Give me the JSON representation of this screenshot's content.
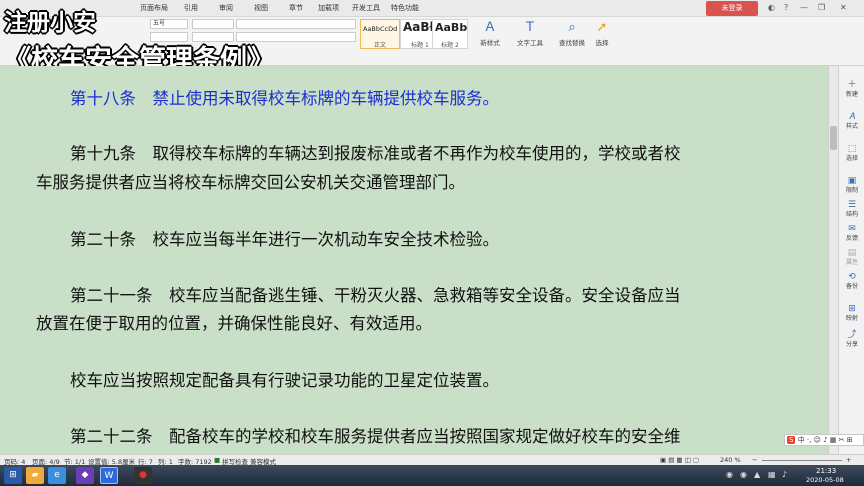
{
  "menu": {
    "items": [
      "页面布局",
      "引用",
      "审阅",
      "视图",
      "章节",
      "加载项",
      "开发工具",
      "特色功能"
    ],
    "login": "未登录"
  },
  "toolbar": {
    "font_size": "五号",
    "styles": [
      {
        "sample": "AaBbCcDd",
        "label": "正文"
      },
      {
        "sample": "AaBł",
        "label": "标题 1"
      },
      {
        "sample": "AaBb",
        "label": "标题 2"
      }
    ],
    "new_style": "新样式",
    "text_tools": "文字工具",
    "find_replace": "查找替换",
    "select": "选择"
  },
  "overlay": {
    "line1": "注册小安",
    "line2": "《校车安全管理条例》"
  },
  "document": {
    "paragraphs": [
      {
        "lines": [
          "第十八条　禁止使用未取得校车标牌的车辆提供校车服务。"
        ],
        "heading": true
      },
      {
        "lines": [
          "第十九条　取得校车标牌的车辆达到报废标准或者不再作为校车使用的，学校或者校",
          "车服务提供者应当将校车标牌交回公安机关交通管理部门。"
        ]
      },
      {
        "lines": [
          "第二十条　校车应当每半年进行一次机动车安全技术检验。"
        ]
      },
      {
        "lines": [
          "第二十一条　校车应当配备逃生锤、干粉灭火器、急救箱等安全设备。安全设备应当",
          "放置在便于取用的位置，并确保性能良好、有效适用。"
        ]
      },
      {
        "lines": [
          "校车应当按照规定配备具有行驶记录功能的卫星定位装置。"
        ]
      },
      {
        "lines": [
          "第二十二条　配备校车的学校和校车服务提供者应当按照国家规定做好校车的安全维"
        ]
      }
    ]
  },
  "right_pane": [
    "新建",
    "样式",
    "选择",
    "限制",
    "结构",
    "反馈",
    "属性",
    "备份",
    "映射",
    "分享"
  ],
  "status": {
    "page_num": "页码: 4",
    "pages": "页面: 4/9",
    "section": "节: 1/1",
    "setting": "设置值: 5.8厘米",
    "row": "行: 7",
    "col": "列: 1",
    "word_count": "字数: 7192",
    "spell": "拼写检查",
    "compat": "兼容模式",
    "zoom": "240 %"
  },
  "ime": {
    "logo": "S",
    "text": "中 ·, ☺ ♪ ▦ ✂ ⊞"
  },
  "taskbar": {
    "time": "21:33",
    "date": "2020-05-08"
  }
}
